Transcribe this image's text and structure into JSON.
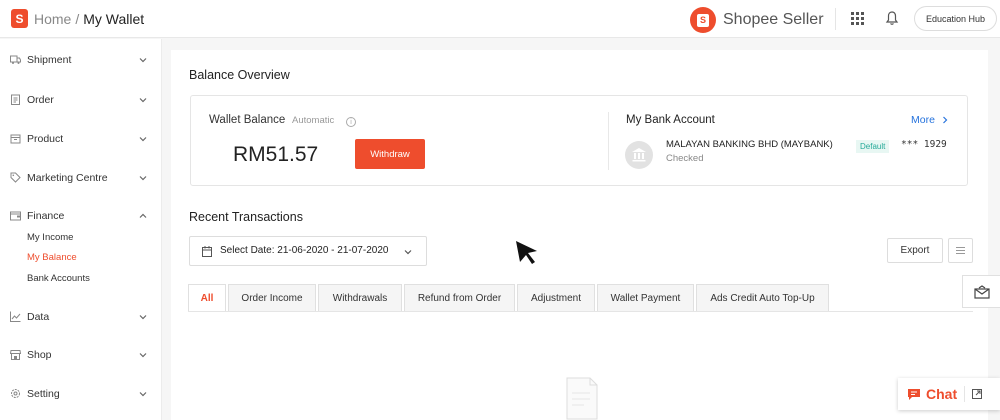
{
  "header": {
    "logo_letter": "S",
    "breadcrumb_home": "Home",
    "breadcrumb_sep": "/",
    "breadcrumb_current": "My Wallet",
    "brand_name": "Shopee Seller",
    "education_hub": "Education Hub"
  },
  "sidebar": {
    "items": [
      {
        "label": "Shipment",
        "icon": "truck-icon"
      },
      {
        "label": "Order",
        "icon": "clipboard-icon"
      },
      {
        "label": "Product",
        "icon": "box-icon"
      },
      {
        "label": "Marketing Centre",
        "icon": "tag-icon"
      },
      {
        "label": "Finance",
        "icon": "wallet-icon"
      },
      {
        "label": "Data",
        "icon": "chart-icon"
      },
      {
        "label": "Shop",
        "icon": "shop-icon"
      },
      {
        "label": "Setting",
        "icon": "gear-icon"
      }
    ],
    "finance_sub": [
      "My Income",
      "My Balance",
      "Bank Accounts"
    ]
  },
  "overview": {
    "title": "Balance Overview",
    "wallet_label": "Wallet Balance",
    "wallet_auto": "Automatic",
    "amount": "RM51.57",
    "withdraw": "Withdraw",
    "bank_title": "My Bank Account",
    "more": "More",
    "bank_name": "MALAYAN BANKING BHD (MAYBANK)",
    "bank_status": "Checked",
    "default_badge": "Default",
    "acct_masked": "*** 1929"
  },
  "transactions": {
    "title": "Recent Transactions",
    "date_label": "Select Date: 21-06-2020 - 21-07-2020",
    "export": "Export",
    "tabs": [
      "All",
      "Order Income",
      "Withdrawals",
      "Refund from Order",
      "Adjustment",
      "Wallet Payment",
      "Ads Credit Auto Top-Up"
    ],
    "active_tab": "All"
  },
  "chat": {
    "label": "Chat"
  },
  "colors": {
    "accent": "#ee4d2d",
    "link": "#2673dd",
    "badge_text": "#26aa99"
  }
}
